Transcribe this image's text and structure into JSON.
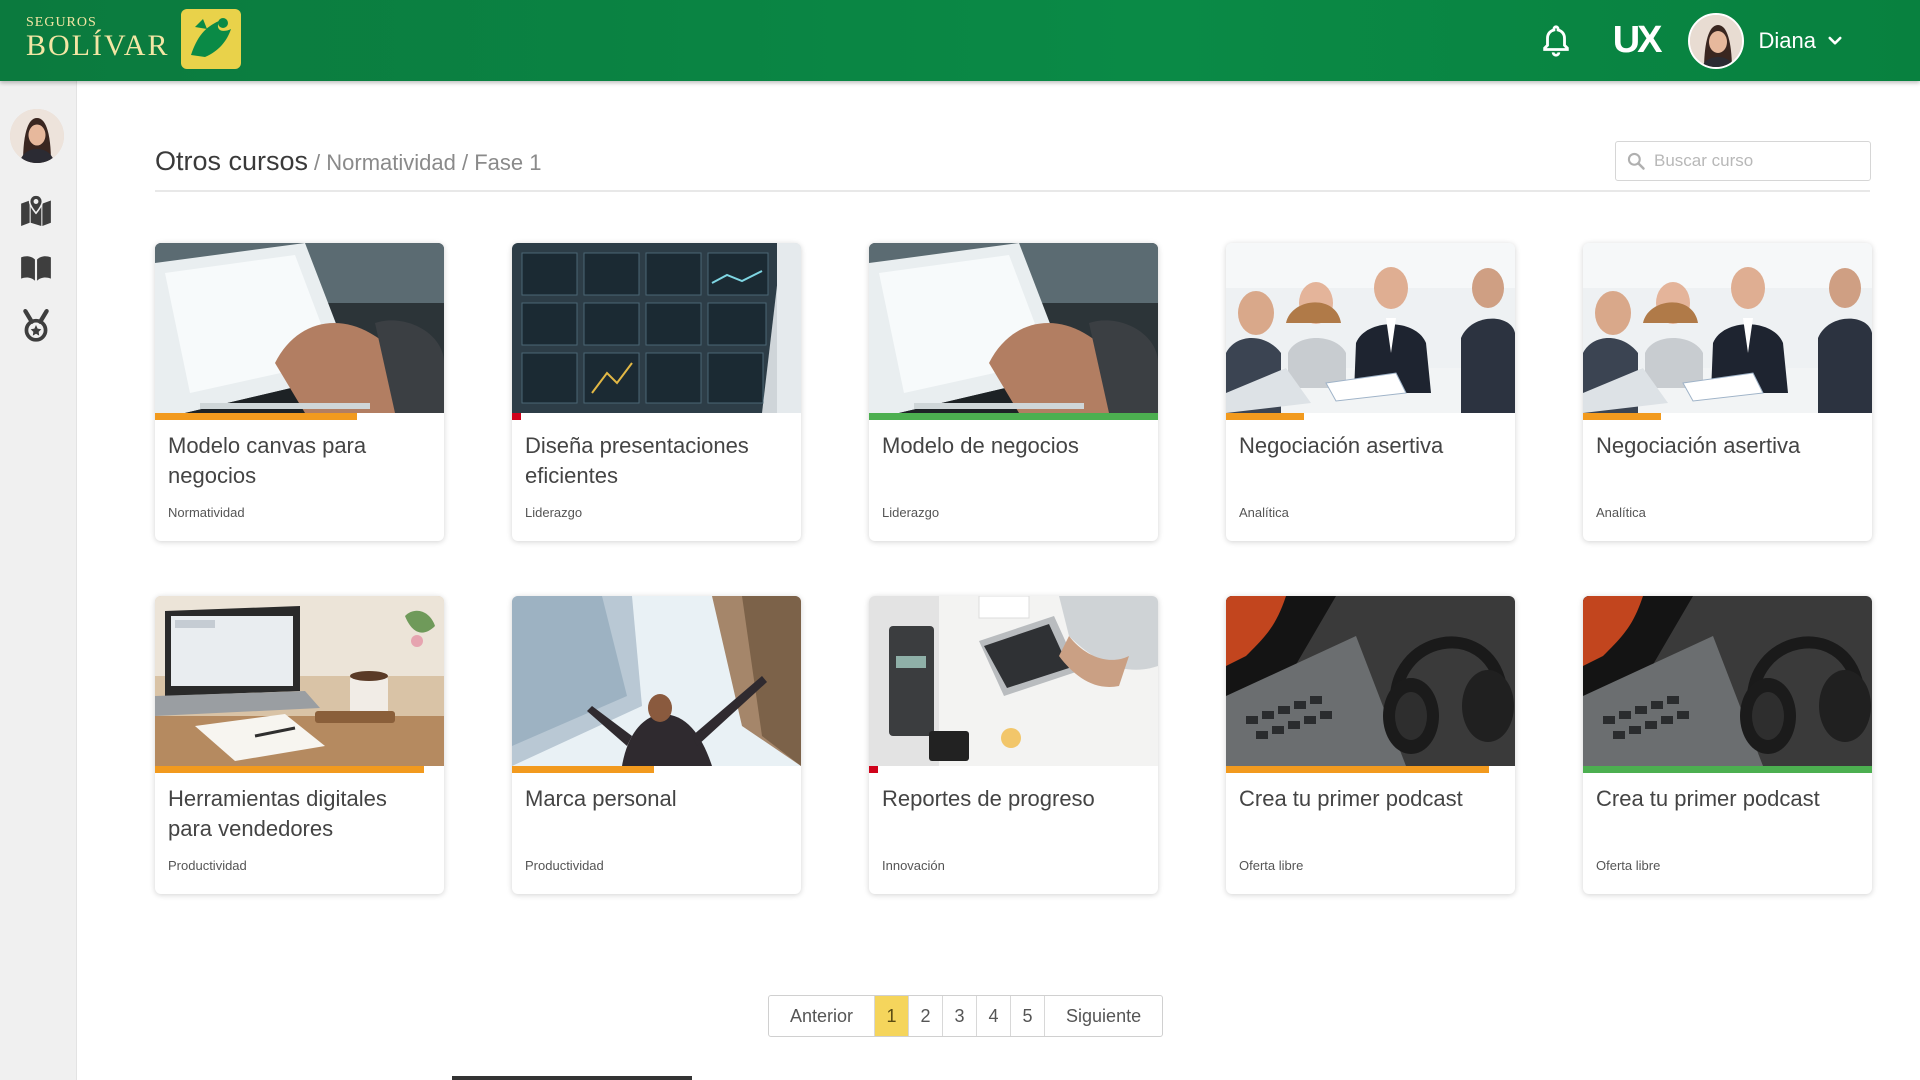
{
  "colors": {
    "header_green": "#0a8a46",
    "brand_gold": "#f3e6a4",
    "progress_orange": "#f29a1e",
    "progress_green": "#4caf50",
    "progress_red": "#d0021b",
    "pager_active": "#f5d55c"
  },
  "header": {
    "brand_small": "SEGUROS",
    "brand_big": "BOLÍVAR",
    "bell_icon": "bell-icon",
    "ux_logo": "UX",
    "user_name": "Diana",
    "chevron_icon": "chevron-down-icon"
  },
  "sidebar": {
    "items": [
      {
        "icon": "map-marker-icon"
      },
      {
        "icon": "book-icon"
      },
      {
        "icon": "medal-icon"
      }
    ]
  },
  "main": {
    "title": "Otros cursos",
    "breadcrumb": "/ Normatividad / Fase 1",
    "search_placeholder": "Buscar curso"
  },
  "courses": [
    {
      "title": "Modelo canvas para negocios",
      "category": "Normatividad",
      "image": "laptop-typing",
      "progress": 0.7,
      "progress_color": "orange"
    },
    {
      "title": "Diseña presentaciones eficientes",
      "category": "Liderazgo",
      "image": "trading-screens",
      "progress": 0.03,
      "progress_color": "red"
    },
    {
      "title": "Modelo de negocios",
      "category": "Liderazgo",
      "image": "laptop-typing",
      "progress": 1.0,
      "progress_color": "green"
    },
    {
      "title": "Negociación asertiva",
      "category": "Analítica",
      "image": "business-meeting",
      "progress": 0.27,
      "progress_color": "orange"
    },
    {
      "title": "Negociación asertiva",
      "category": "Analítica",
      "image": "business-meeting",
      "progress": 0.27,
      "progress_color": "orange"
    },
    {
      "title": "Herramientas digitales para vendedores",
      "category": "Productividad",
      "image": "desk-laptop-coffee",
      "progress": 0.93,
      "progress_color": "orange"
    },
    {
      "title": "Marca personal",
      "category": "Productividad",
      "image": "man-skyscrapers",
      "progress": 0.49,
      "progress_color": "orange"
    },
    {
      "title": "Reportes de progreso",
      "category": "Innovación",
      "image": "office-desk-topview",
      "progress": 0.03,
      "progress_color": "red"
    },
    {
      "title": "Crea tu primer podcast",
      "category": "Oferta libre",
      "image": "headphones-laptop",
      "progress": 0.91,
      "progress_color": "orange"
    },
    {
      "title": "Crea tu primer podcast",
      "category": "Oferta libre",
      "image": "headphones-laptop",
      "progress": 1.0,
      "progress_color": "green"
    }
  ],
  "pagination": {
    "prev": "Anterior",
    "pages": [
      "1",
      "2",
      "3",
      "4",
      "5"
    ],
    "active": "1",
    "next": "Siguiente"
  }
}
